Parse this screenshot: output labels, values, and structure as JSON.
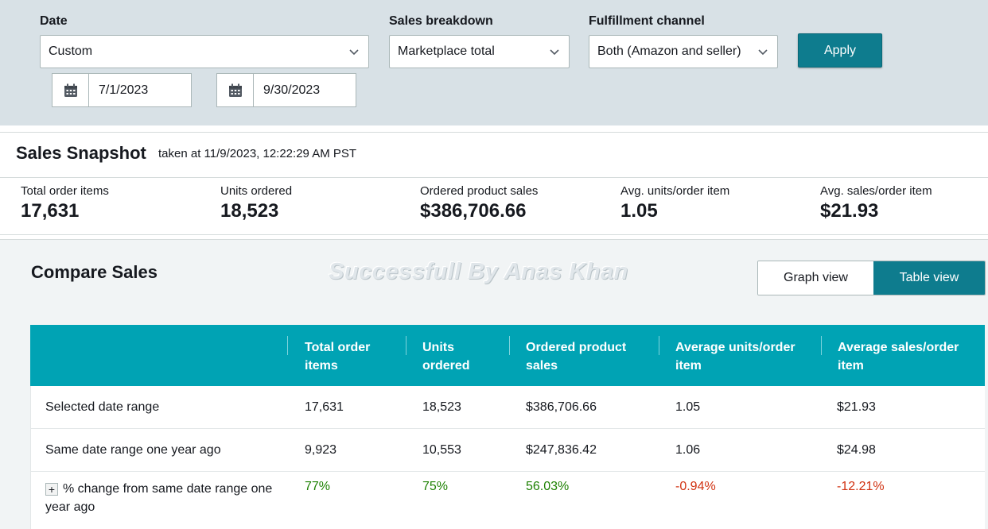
{
  "filters": {
    "date_label": "Date",
    "date_value": "Custom",
    "start_date": "7/1/2023",
    "end_date": "9/30/2023",
    "breakdown_label": "Sales breakdown",
    "breakdown_value": "Marketplace total",
    "channel_label": "Fulfillment channel",
    "channel_value": "Both (Amazon and seller)",
    "apply_label": "Apply"
  },
  "snapshot": {
    "title": "Sales Snapshot",
    "timestamp": "taken at 11/9/2023, 12:22:29 AM PST",
    "metrics": [
      {
        "label": "Total order items",
        "value": "17,631"
      },
      {
        "label": "Units ordered",
        "value": "18,523"
      },
      {
        "label": "Ordered product sales",
        "value": "$386,706.66"
      },
      {
        "label": "Avg. units/order item",
        "value": "1.05"
      },
      {
        "label": "Avg. sales/order item",
        "value": "$21.93"
      }
    ]
  },
  "compare": {
    "title": "Compare Sales",
    "watermark": "Successfull By Anas Khan",
    "graph_view_label": "Graph view",
    "table_view_label": "Table view",
    "columns": [
      "Total order items",
      "Units ordered",
      "Ordered product sales",
      "Average units/order item",
      "Average sales/order item"
    ],
    "rows": [
      {
        "label": "Selected date range",
        "cells": [
          "17,631",
          "18,523",
          "$386,706.66",
          "1.05",
          "$21.93"
        ]
      },
      {
        "label": "Same date range one year ago",
        "cells": [
          "9,923",
          "10,553",
          "$247,836.42",
          "1.06",
          "$24.98"
        ]
      },
      {
        "label": "% change from same date range one year ago",
        "cells": [
          "77%",
          "75%",
          "56.03%",
          "-0.94%",
          "-12.21%"
        ]
      }
    ]
  },
  "colors": {
    "accent": "#0e7c8e",
    "table_header": "#00a3b4",
    "positive": "#1d8102",
    "negative": "#d13212"
  }
}
